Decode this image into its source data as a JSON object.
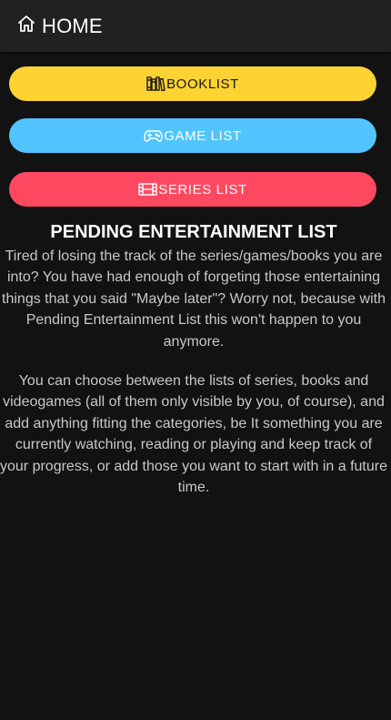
{
  "header": {
    "title": "HOME",
    "icon": "home-icon"
  },
  "buttons": {
    "booklist": {
      "label": "BOOKLIST",
      "icon": "bookshelf-icon",
      "color": "#fdd233"
    },
    "gamelist": {
      "label": "GAME LIST",
      "icon": "gamepad-icon",
      "color": "#52c4ff"
    },
    "serieslist": {
      "label": "SERIES LIST",
      "icon": "film-icon",
      "color": "#ff4960"
    }
  },
  "content": {
    "title": "PENDING ENTERTAINMENT LIST",
    "paragraph_1": "Tired of losing the track of the series/games/books you are into? You have had enough of forgeting those entertaining things that you said \"Maybe later\"? Worry not, because with Pending Entertainment List this won't happen to you anymore.",
    "paragraph_2": "You can choose between the lists of series, books and videogames (all of them only visible by you, of course), and add anything fitting the categories, be It something you are currently watching, reading or playing and keep track of your progress, or add those you want to start with in a future time."
  },
  "colors": {
    "background": "#121212",
    "topbar": "#212121"
  }
}
